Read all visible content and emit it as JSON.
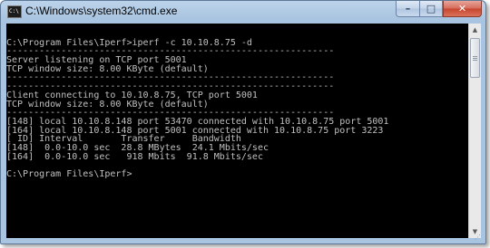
{
  "window": {
    "title": "C:\\Windows\\system32\\cmd.exe",
    "icon_label": "C:\\",
    "buttons": {
      "minimize": "–",
      "maximize": "□",
      "close": "✕"
    }
  },
  "console": {
    "lines": [
      "",
      "C:\\Program Files\\Iperf>iperf -c 10.10.8.75 -d",
      "------------------------------------------------------------",
      "Server listening on TCP port 5001",
      "TCP window size: 8.00 KByte (default)",
      "------------------------------------------------------------",
      "------------------------------------------------------------",
      "Client connecting to 10.10.8.75, TCP port 5001",
      "TCP window size: 8.00 KByte (default)",
      "------------------------------------------------------------",
      "[148] local 10.10.8.148 port 53470 connected with 10.10.8.75 port 5001",
      "[164] local 10.10.8.148 port 5001 connected with 10.10.8.75 port 3223",
      "[ ID] Interval       Transfer     Bandwidth",
      "[148]  0.0-10.0 sec  28.8 MBytes  24.1 Mbits/sec",
      "[164]  0.0-10.0 sec   918 Mbits  91.8 Mbits/sec",
      "",
      "C:\\Program Files\\Iperf>"
    ]
  },
  "scrollbar": {
    "up_arrow": "▲",
    "down_arrow": "▼"
  }
}
